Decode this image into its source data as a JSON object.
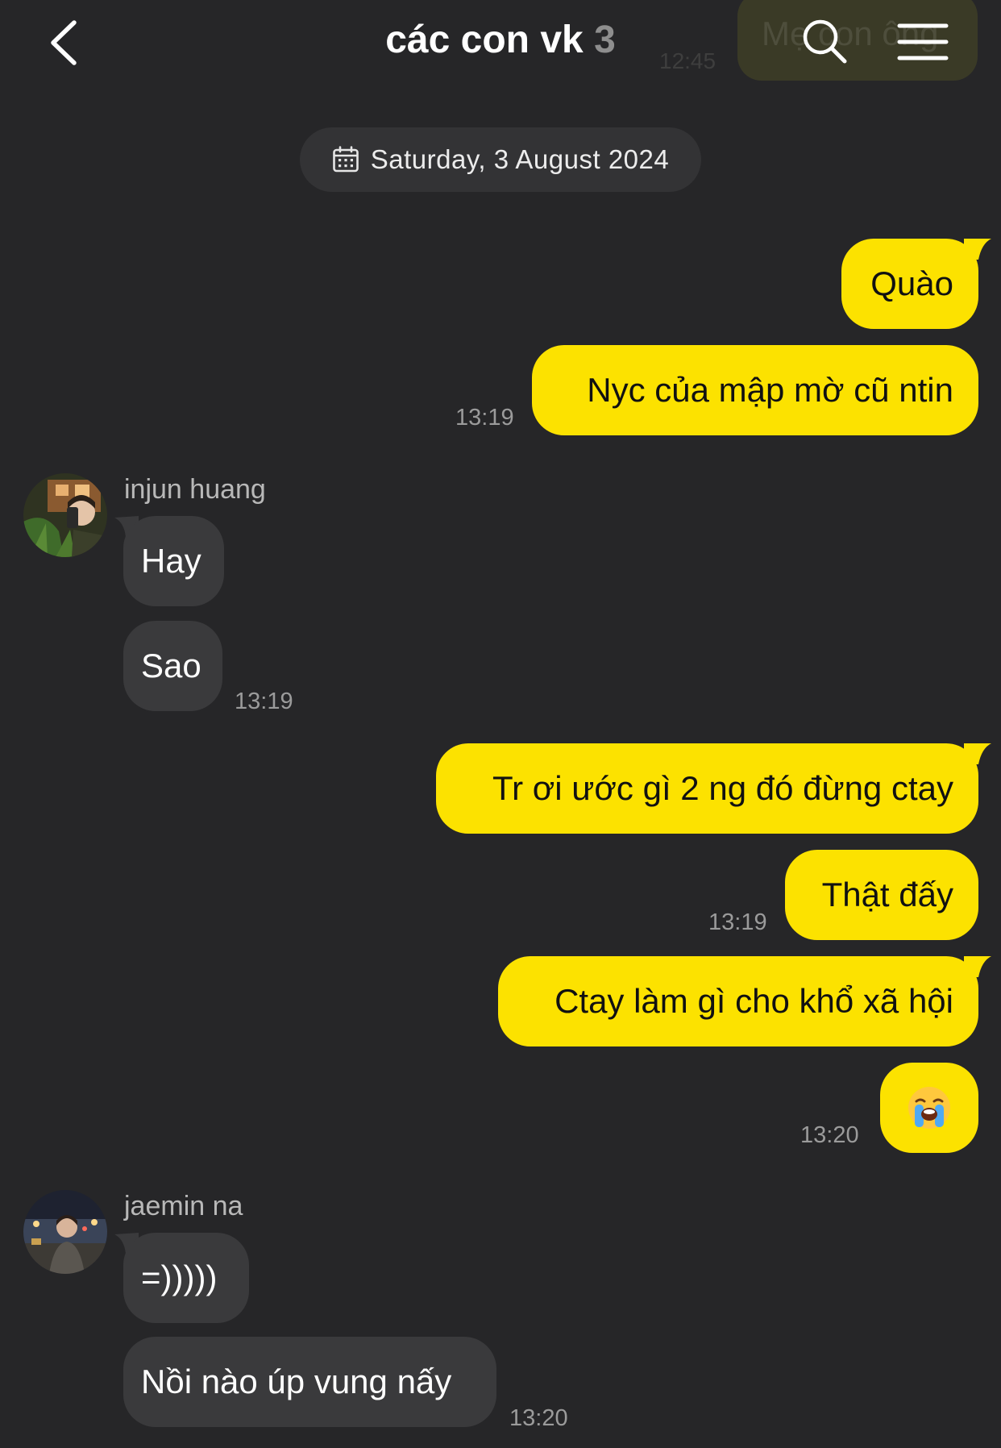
{
  "header": {
    "title": "các con vk",
    "member_count": "3",
    "behind_bubble_text": "Mẹ con ông",
    "behind_time": "12:45"
  },
  "date_divider": {
    "label": "Saturday, 3 August 2024"
  },
  "messages": [
    {
      "sender": "me",
      "text": "Quào"
    },
    {
      "sender": "me",
      "text": "Nyc của mập mờ cũ ntin",
      "time": "13:19"
    },
    {
      "sender": "injun huang",
      "text": "Hay"
    },
    {
      "sender": "injun huang",
      "text": "Sao",
      "time": "13:19"
    },
    {
      "sender": "me",
      "text": "Tr ơi ước gì 2 ng đó đừng ctay"
    },
    {
      "sender": "me",
      "text": "Thật đấy",
      "time": "13:19"
    },
    {
      "sender": "me",
      "text": "Ctay làm gì cho khổ xã hội"
    },
    {
      "sender": "me",
      "emoji": "loudly-crying-face",
      "time": "13:20"
    },
    {
      "sender": "jaemin na",
      "text": "=)))))"
    },
    {
      "sender": "jaemin na",
      "text": "Nồi nào úp vung nấy",
      "time": "13:20"
    }
  ],
  "colors": {
    "background": "#262628",
    "outgoing_bubble": "#fce200",
    "incoming_bubble": "#3a3a3c",
    "timestamp": "#9b9b9b"
  },
  "icons": [
    "chevron-left-icon",
    "search-icon",
    "menu-icon",
    "calendar-icon"
  ]
}
